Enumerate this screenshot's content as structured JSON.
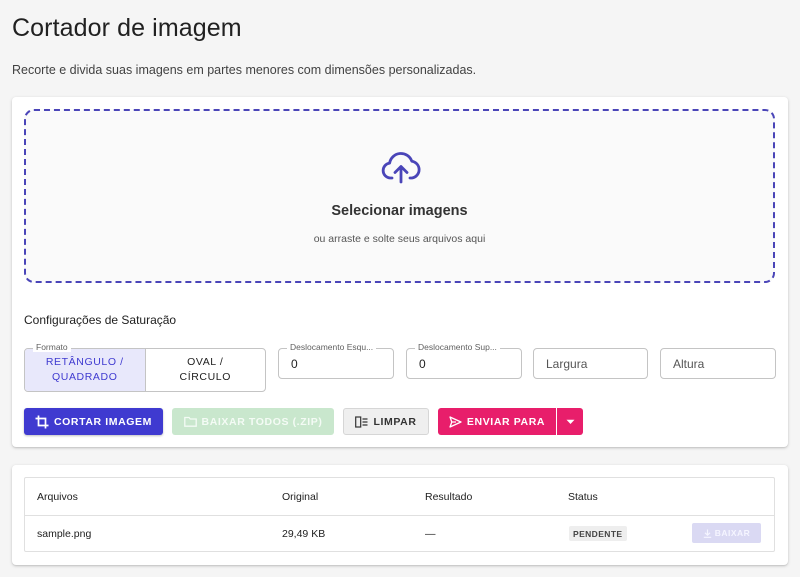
{
  "header": {
    "title": "Cortador de imagem",
    "subtitle": "Recorte e divida suas imagens em partes menores com dimensões personalizadas."
  },
  "dropzone": {
    "title": "Selecionar imagens",
    "subtitle": "ou arraste e solte seus arquivos aqui",
    "icon": "cloud-upload-icon"
  },
  "settings": {
    "title": "Configurações de Saturação",
    "format": {
      "legend": "Formato",
      "options": [
        "RETÂNGULO / QUADRADO",
        "OVAL / CÍRCULO"
      ],
      "option_lines": [
        [
          "RETÂNGULO /",
          "QUADRADO"
        ],
        [
          "OVAL /",
          "CÍRCULO"
        ]
      ],
      "selected": "RETÂNGULO / QUADRADO"
    },
    "offset_left": {
      "legend": "Deslocamento Esqu...",
      "value": "0"
    },
    "offset_top": {
      "legend": "Deslocamento Sup...",
      "value": "0"
    },
    "width": {
      "placeholder": "Largura",
      "value": ""
    },
    "height": {
      "placeholder": "Altura",
      "value": ""
    }
  },
  "actions": {
    "cut": "CORTAR IMAGEM",
    "download_all": "BAIXAR TODOS (.ZIP)",
    "clear": "LIMPAR",
    "send_to": "ENVIAR PARA"
  },
  "table": {
    "columns": [
      "Arquivos",
      "Original",
      "Resultado",
      "Status"
    ],
    "rows": [
      {
        "file": "sample.png",
        "original": "29,49 KB",
        "result": "—",
        "status": "PENDENTE",
        "action": "BAIXAR"
      }
    ]
  },
  "colors": {
    "primary": "#3f3ad0",
    "accent": "#e81e6b",
    "success_disabled": "#c9e7cd",
    "dropzone_border": "#4a45b8"
  }
}
